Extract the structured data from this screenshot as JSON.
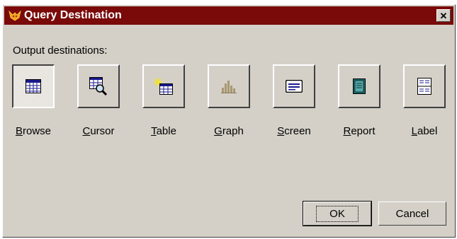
{
  "window": {
    "title": "Query Destination",
    "close_glyph": "✕"
  },
  "output_label": "Output destinations:",
  "destinations": [
    {
      "label_first": "B",
      "label_rest": "rowse",
      "icon": "browse-grid-icon",
      "pressed": true
    },
    {
      "label_first": "C",
      "label_rest": "ursor",
      "icon": "cursor-magnifier-icon",
      "pressed": false
    },
    {
      "label_first": "T",
      "label_rest": "able",
      "icon": "table-sparkle-icon",
      "pressed": false
    },
    {
      "label_first": "G",
      "label_rest": "raph",
      "icon": "graph-bars-icon",
      "pressed": false
    },
    {
      "label_first": "S",
      "label_rest": "creen",
      "icon": "screen-icon",
      "pressed": false
    },
    {
      "label_first": "R",
      "label_rest": "eport",
      "icon": "report-book-icon",
      "pressed": false
    },
    {
      "label_first": "L",
      "label_rest": "abel",
      "icon": "label-card-icon",
      "pressed": false
    }
  ],
  "buttons": {
    "ok": "OK",
    "cancel": "Cancel"
  },
  "colors": {
    "titlebar": "#7a0909",
    "face": "#d4d0c8",
    "icon_blue": "#1a1a8c"
  }
}
